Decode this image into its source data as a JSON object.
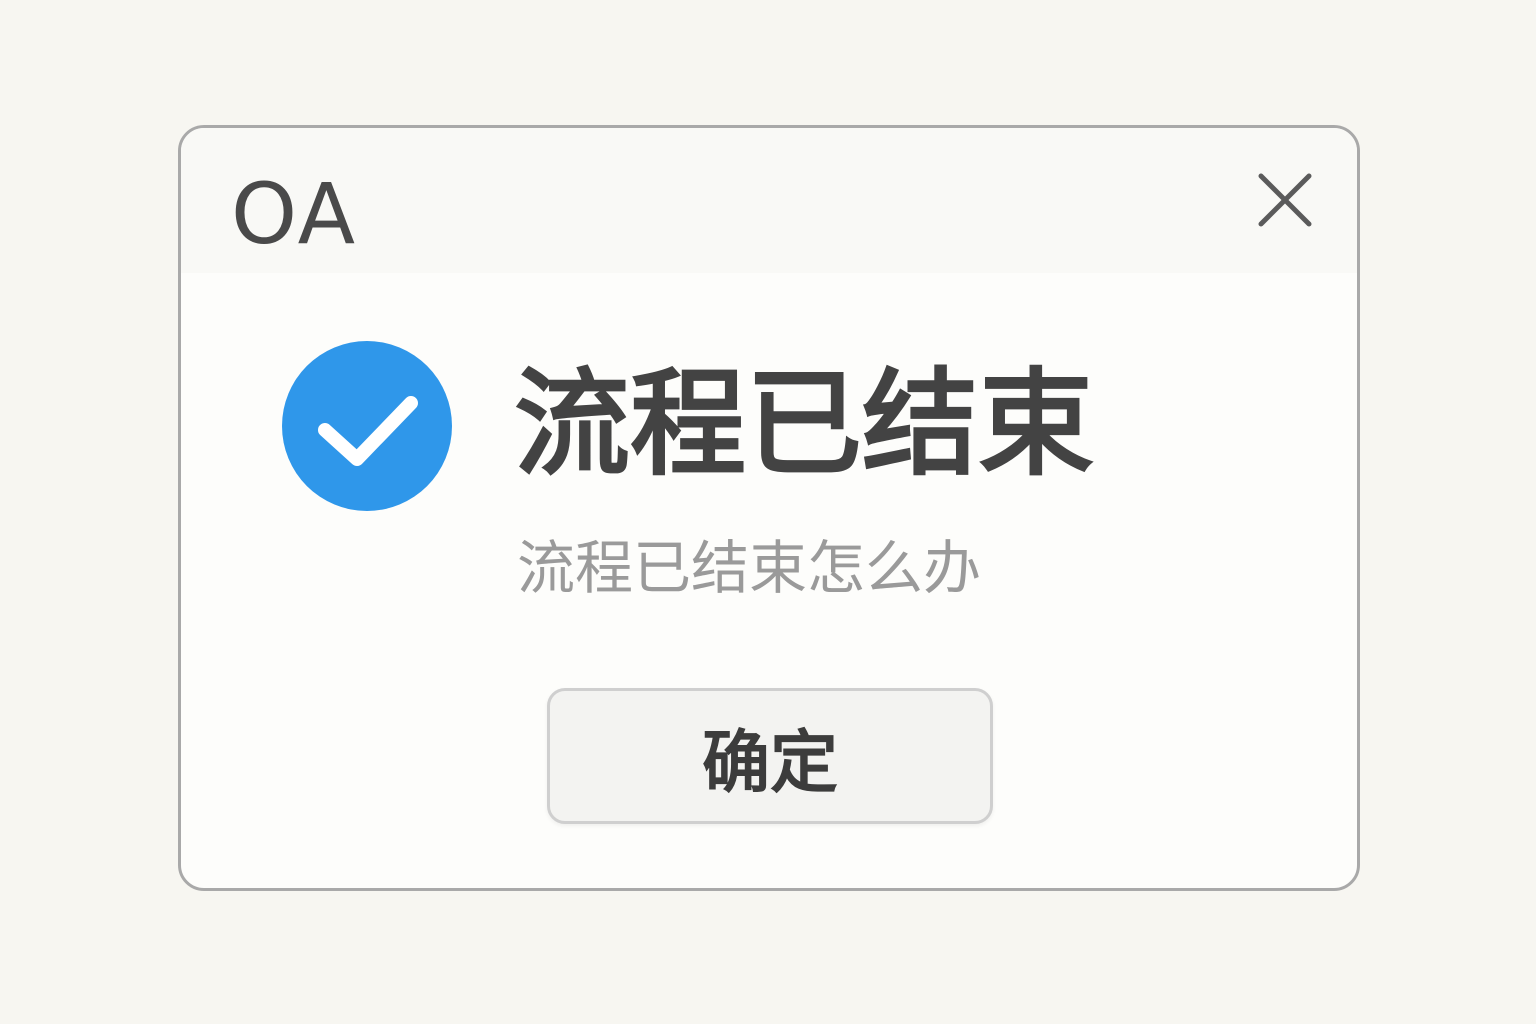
{
  "dialog": {
    "app_title": "OA",
    "close_icon": "close-icon",
    "status_icon": "check-circle-icon",
    "status_color": "#2f97ea",
    "title": "流程已结束",
    "subtitle": "流程已结束怎么办",
    "confirm_label": "确定"
  }
}
